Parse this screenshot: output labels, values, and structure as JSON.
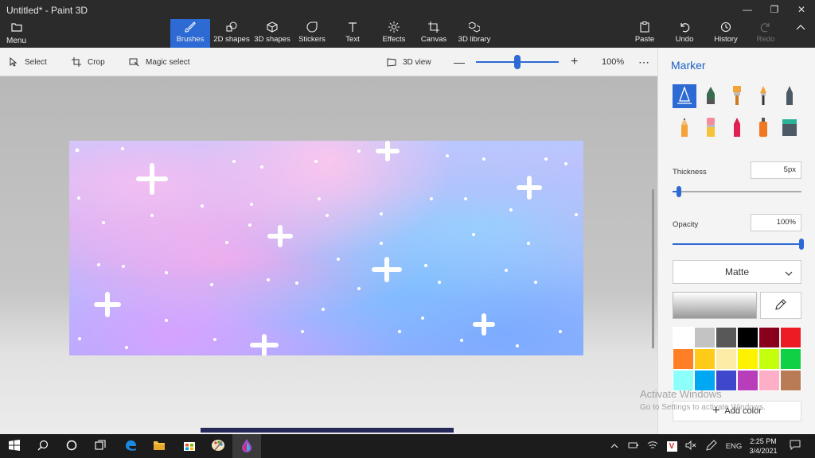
{
  "window": {
    "title": "Untitled* - Paint 3D",
    "controls": [
      "minimize",
      "restore",
      "close"
    ]
  },
  "ribbon": {
    "menu_label": "Menu",
    "tabs": [
      {
        "label": "Brushes",
        "icon": "brush-icon",
        "active": true
      },
      {
        "label": "2D shapes",
        "icon": "2d-shapes-icon"
      },
      {
        "label": "3D shapes",
        "icon": "3d-shapes-icon"
      },
      {
        "label": "Stickers",
        "icon": "stickers-icon"
      },
      {
        "label": "Text",
        "icon": "text-icon"
      },
      {
        "label": "Effects",
        "icon": "effects-icon"
      },
      {
        "label": "Canvas",
        "icon": "canvas-icon"
      },
      {
        "label": "3D library",
        "icon": "3d-library-icon"
      }
    ],
    "actions": [
      {
        "label": "Paste",
        "icon": "paste-icon"
      },
      {
        "label": "Undo",
        "icon": "undo-icon"
      },
      {
        "label": "History",
        "icon": "history-icon"
      },
      {
        "label": "Redo",
        "icon": "redo-icon",
        "disabled": true
      }
    ]
  },
  "toolbar": {
    "select_label": "Select",
    "crop_label": "Crop",
    "magic_select_label": "Magic select",
    "view3d_label": "3D view",
    "zoom_value": "100%",
    "zoom_fraction": 0.5
  },
  "panel": {
    "title": "Marker",
    "brushes": [
      {
        "icon": "marker-icon",
        "active": true
      },
      {
        "icon": "calligraphy-pen-icon"
      },
      {
        "icon": "oil-brush-icon"
      },
      {
        "icon": "watercolor-icon"
      },
      {
        "icon": "pixel-pen-icon"
      },
      {
        "icon": "pencil-icon"
      },
      {
        "icon": "eraser-icon"
      },
      {
        "icon": "crayon-icon"
      },
      {
        "icon": "spray-can-icon"
      },
      {
        "icon": "fill-bucket-icon"
      }
    ],
    "thickness_label": "Thickness",
    "thickness_value": "5px",
    "thickness_fraction": 0.05,
    "opacity_label": "Opacity",
    "opacity_value": "100%",
    "opacity_fraction": 1.0,
    "finish_value": "Matte",
    "palette": [
      "#ffffff",
      "#c3c3c3",
      "#585858",
      "#000000",
      "#88001b",
      "#ec1c24",
      "#ff7f27",
      "#ffca18",
      "#fdeca6",
      "#fff200",
      "#c4ff0e",
      "#0ed145",
      "#8cfffb",
      "#00a8f3",
      "#3f48cc",
      "#b83dba",
      "#ffaec8",
      "#b97a56"
    ],
    "add_color_label": "Add color"
  },
  "watermark": {
    "line1": "Activate Windows",
    "line2": "Go to Settings to activate Windows."
  },
  "taskbar": {
    "apps": [
      "windows-start-icon",
      "search-icon",
      "cortana-icon",
      "task-view-icon",
      "edge-icon",
      "file-explorer-icon",
      "store-icon",
      "paint-icon",
      "paint-3d-icon"
    ],
    "lang": "ENG",
    "time": "2:25 PM",
    "date": "3/4/2021"
  }
}
